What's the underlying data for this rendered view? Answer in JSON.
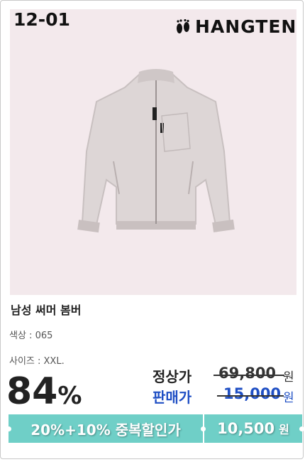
{
  "product": {
    "code": "12-01",
    "brand": "HANGTEN",
    "name": "남성 써머 봄버",
    "color_label": "색상 : 065",
    "size_label": "사이즈 : XXL.",
    "discount": "84",
    "discount_sign": "%"
  },
  "pricing": {
    "regular_label": "정상가",
    "regular_price": "69,800",
    "sale_label": "판매가",
    "sale_price": "15,000",
    "won": "원",
    "promo_text": "20%+10% 중복할인가",
    "final_price": "10,500"
  },
  "colors": {
    "photo_bg": "#f3e9ec",
    "accent_teal": "#6fcfc7",
    "sale_blue": "#1f4fc4",
    "text_dark": "#222222"
  },
  "icons": [
    "footprint-icon"
  ]
}
